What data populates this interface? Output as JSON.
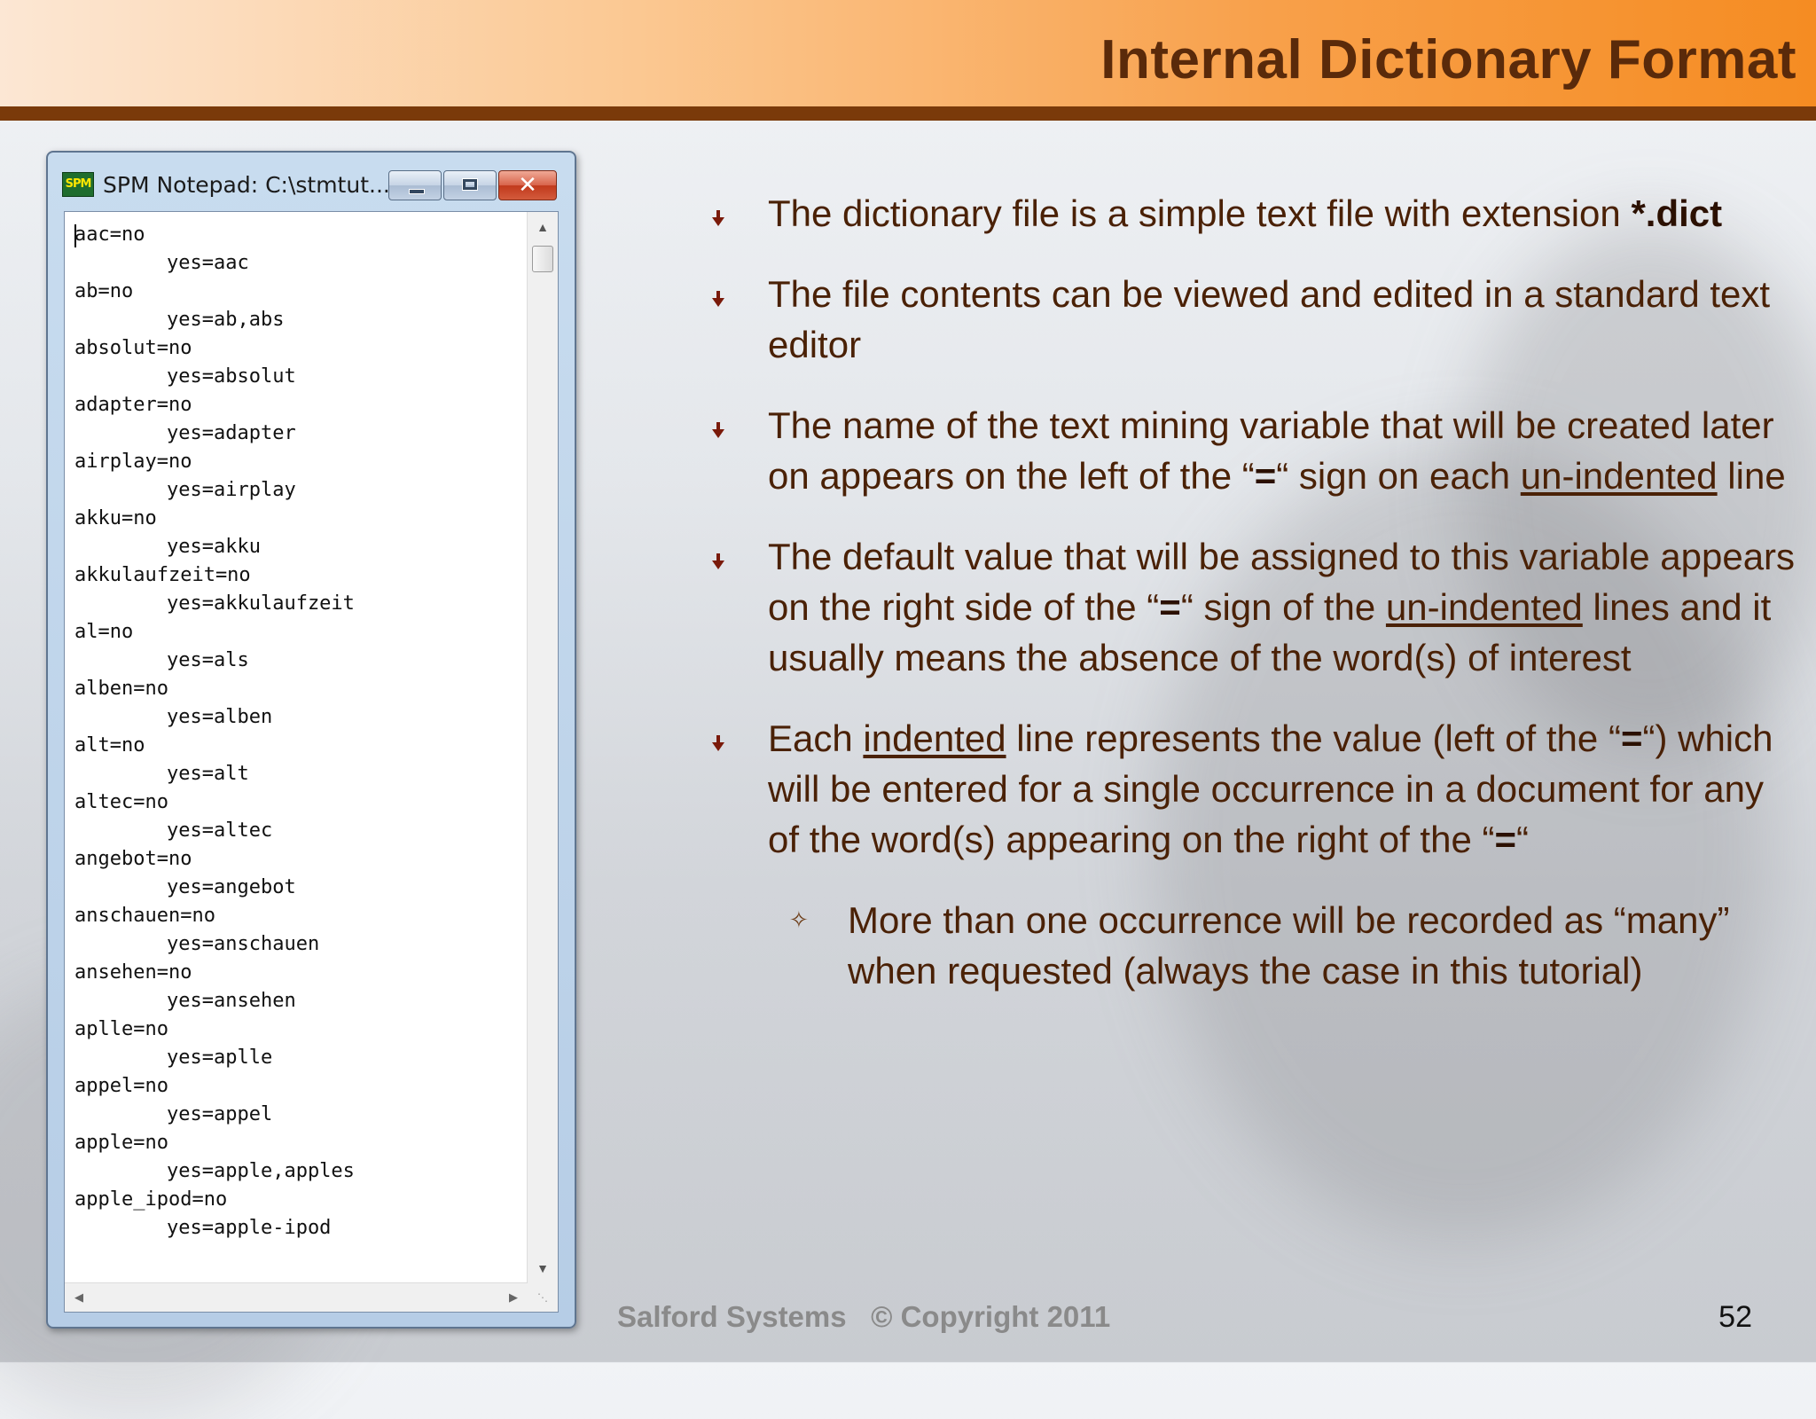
{
  "slide": {
    "title": "Internal Dictionary Format",
    "footer": "Salford Systems   © Copyright 2011",
    "page_number": "52"
  },
  "notepad": {
    "app_icon_label": "SPM",
    "window_title": "SPM Notepad: C:\\stmtut...",
    "close_glyph": "✕",
    "lines": [
      {
        "text": "aac=no",
        "indent": false
      },
      {
        "text": "yes=aac",
        "indent": true
      },
      {
        "text": "ab=no",
        "indent": false
      },
      {
        "text": "yes=ab,abs",
        "indent": true
      },
      {
        "text": "absolut=no",
        "indent": false
      },
      {
        "text": "yes=absolut",
        "indent": true
      },
      {
        "text": "adapter=no",
        "indent": false
      },
      {
        "text": "yes=adapter",
        "indent": true
      },
      {
        "text": "airplay=no",
        "indent": false
      },
      {
        "text": "yes=airplay",
        "indent": true
      },
      {
        "text": "akku=no",
        "indent": false
      },
      {
        "text": "yes=akku",
        "indent": true
      },
      {
        "text": "akkulaufzeit=no",
        "indent": false
      },
      {
        "text": "yes=akkulaufzeit",
        "indent": true
      },
      {
        "text": "al=no",
        "indent": false
      },
      {
        "text": "yes=als",
        "indent": true
      },
      {
        "text": "alben=no",
        "indent": false
      },
      {
        "text": "yes=alben",
        "indent": true
      },
      {
        "text": "alt=no",
        "indent": false
      },
      {
        "text": "yes=alt",
        "indent": true
      },
      {
        "text": "altec=no",
        "indent": false
      },
      {
        "text": "yes=altec",
        "indent": true
      },
      {
        "text": "angebot=no",
        "indent": false
      },
      {
        "text": "yes=angebot",
        "indent": true
      },
      {
        "text": "anschauen=no",
        "indent": false
      },
      {
        "text": "yes=anschauen",
        "indent": true
      },
      {
        "text": "ansehen=no",
        "indent": false
      },
      {
        "text": "yes=ansehen",
        "indent": true
      },
      {
        "text": "aplle=no",
        "indent": false
      },
      {
        "text": "yes=aplle",
        "indent": true
      },
      {
        "text": "appel=no",
        "indent": false
      },
      {
        "text": "yes=appel",
        "indent": true
      },
      {
        "text": "apple=no",
        "indent": false
      },
      {
        "text": "yes=apple,apples",
        "indent": true
      },
      {
        "text": "apple_ipod=no",
        "indent": false
      },
      {
        "text": "yes=apple-ipod",
        "indent": true
      }
    ]
  },
  "bullets": [
    {
      "level": 1,
      "parts": [
        {
          "t": "The dictionary file is a simple text file with extension "
        },
        {
          "t": "*.dict",
          "b": true
        }
      ]
    },
    {
      "level": 1,
      "parts": [
        {
          "t": "The file contents can be viewed and edited in a standard text editor"
        }
      ]
    },
    {
      "level": 1,
      "parts": [
        {
          "t": "The name of the text mining variable that will be created later on appears on the left of the “"
        },
        {
          "t": "=",
          "b": true
        },
        {
          "t": "“ sign on each "
        },
        {
          "t": "un-indented",
          "u": true
        },
        {
          "t": " line"
        }
      ]
    },
    {
      "level": 1,
      "parts": [
        {
          "t": "The default value that will be assigned to this variable appears on the right side of the “"
        },
        {
          "t": "=",
          "b": true
        },
        {
          "t": "“ sign of the "
        },
        {
          "t": "un-indented",
          "u": true
        },
        {
          "t": " lines and it usually means the absence of the word(s) of interest"
        }
      ]
    },
    {
      "level": 1,
      "parts": [
        {
          "t": "Each "
        },
        {
          "t": "indented",
          "u": true
        },
        {
          "t": " line represents the value (left of the “"
        },
        {
          "t": "=",
          "b": true
        },
        {
          "t": "“) which will be entered for a single occurrence in a document for any of the word(s) appearing on the right of the “"
        },
        {
          "t": "=",
          "b": true
        },
        {
          "t": "“"
        }
      ]
    },
    {
      "level": 2,
      "parts": [
        {
          "t": "More than one occurrence will be recorded as “many” when requested (always the case in this tutorial)"
        }
      ]
    }
  ],
  "colors": {
    "title": "#5a2a0a",
    "body_text": "#4a2106",
    "header_rule": "#7a3a0a",
    "bullet_marker": "#7a1a0a"
  }
}
